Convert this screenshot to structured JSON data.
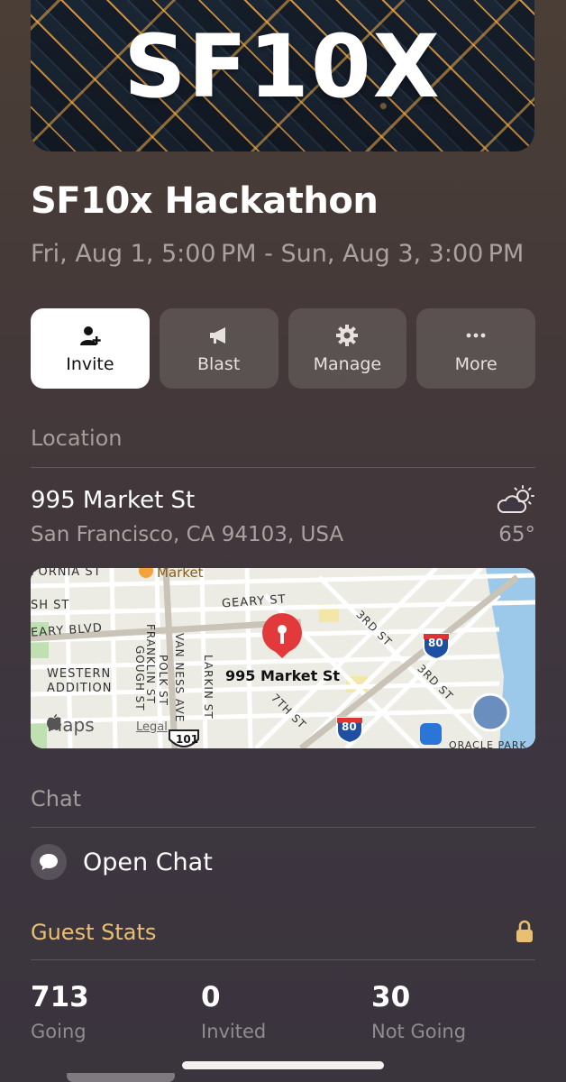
{
  "banner": {
    "text": "SF10X"
  },
  "event": {
    "title": "SF10x Hackathon",
    "dates": "Fri, Aug 1, 5:00 PM - Sun, Aug 3, 3:00 PM"
  },
  "actions": [
    {
      "label": "Invite",
      "icon": "add-person-icon"
    },
    {
      "label": "Blast",
      "icon": "megaphone-icon"
    },
    {
      "label": "Manage",
      "icon": "gear-icon"
    },
    {
      "label": "More",
      "icon": "ellipsis-icon"
    }
  ],
  "location": {
    "section_label": "Location",
    "address_line1": "995 Market St",
    "address_line2": "San Francisco, CA 94103, USA",
    "temperature": "65°",
    "weather_icon": "partly-cloudy-icon"
  },
  "map": {
    "pin_label": "995 Market St",
    "streets": [
      "GEARY ST",
      "EARY BLVD",
      "FORNIA ST",
      "SH ST",
      "3RD ST",
      "3RD ST",
      "7TH ST",
      "POLK ST",
      "LARKIN ST",
      "VAN NESS AVE",
      "FRANKLIN ST",
      "GOUGH ST"
    ],
    "neighborhood": "WESTERN\nADDITION",
    "poi": "Market",
    "poi_2": "ORACLE PARK",
    "brand": "Maps",
    "legal": "Legal",
    "highway_80": "80",
    "highway_101": "101"
  },
  "chat": {
    "section_label": "Chat",
    "open_label": "Open Chat"
  },
  "guest_stats": {
    "section_label": "Guest Stats",
    "stats": [
      {
        "value": "713",
        "label": "Going"
      },
      {
        "value": "0",
        "label": "Invited"
      },
      {
        "value": "30",
        "label": "Not Going"
      }
    ]
  },
  "colors": {
    "accent_gold": "#e9c071",
    "pin_red": "#e23a3a"
  }
}
